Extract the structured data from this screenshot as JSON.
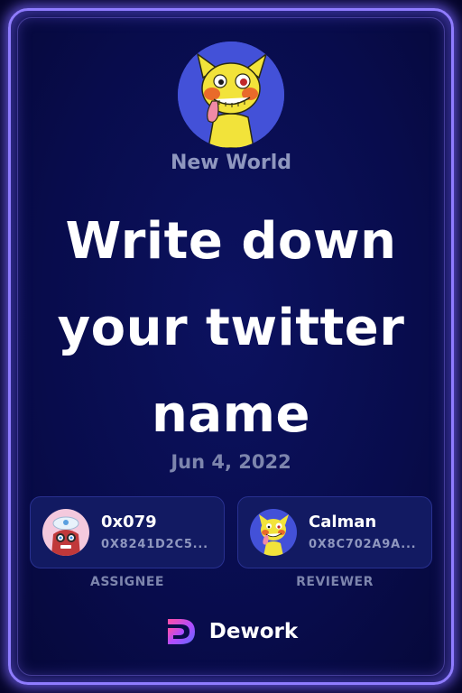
{
  "organization": {
    "name": "New World",
    "avatar_icon": "yellow-dog-avatar-icon",
    "avatar_bg": "#4351d8"
  },
  "task": {
    "title": "Write down your twitter name",
    "date": "Jun 4, 2022"
  },
  "assignee": {
    "name": "0x079",
    "address": "0X8241D2C5...",
    "role_label": "ASSIGNEE",
    "avatar_icon": "red-character-avatar-icon"
  },
  "reviewer": {
    "name": "Calman",
    "address": "0X8C702A9A...",
    "role_label": "REVIEWER",
    "avatar_icon": "yellow-dog-avatar-icon"
  },
  "brand": {
    "name": "Dework",
    "logo_icon": "dework-logo-icon"
  },
  "colors": {
    "frame_glow": "#8f7cff",
    "card_bg": "#121a62",
    "muted_text": "#8f97bf"
  }
}
